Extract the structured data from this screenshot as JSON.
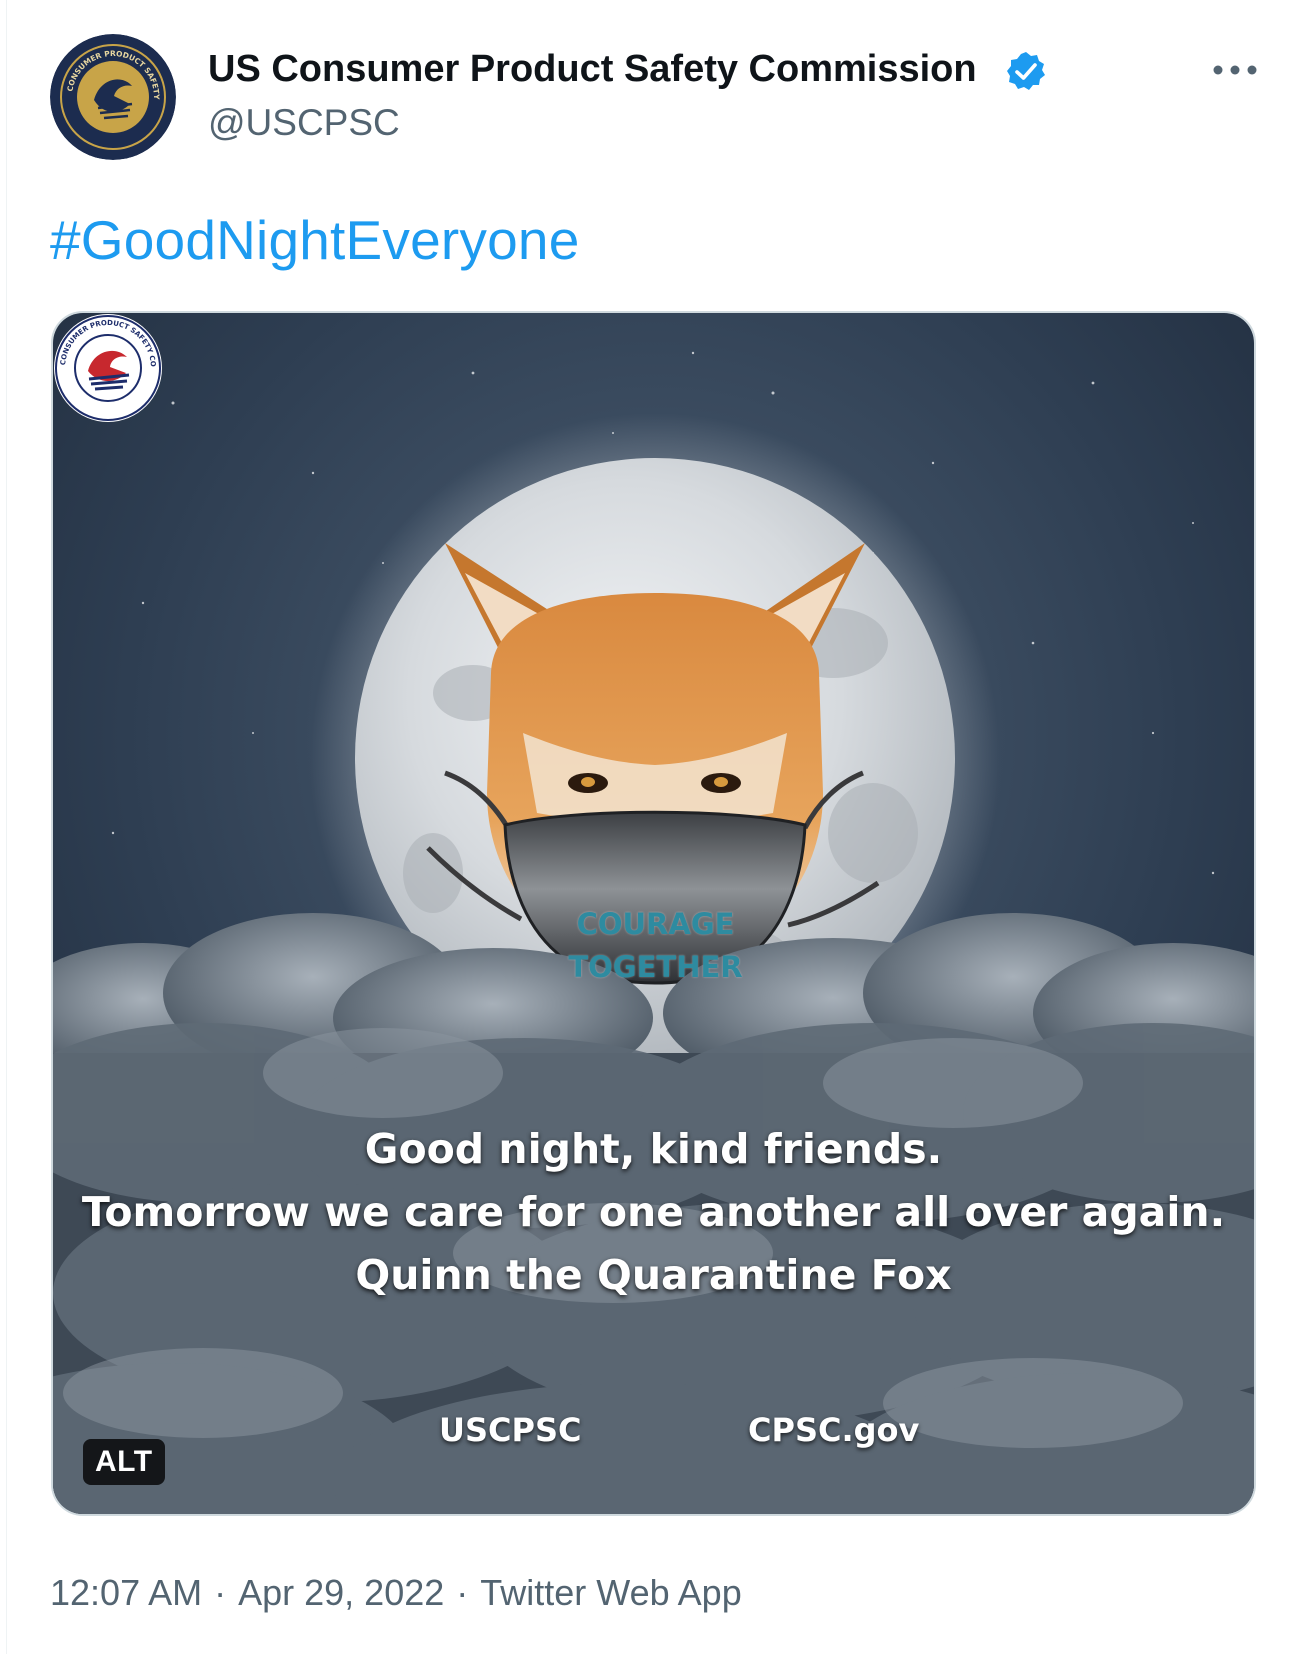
{
  "tweet": {
    "author": {
      "name": "US Consumer Product Safety Commission",
      "handle": "@USCPSC",
      "verified": true,
      "avatar_icon": "cpsc-seal-avatar"
    },
    "more_icon": "more-options-icon",
    "text": "#GoodNightEveryone",
    "media": {
      "mask_text_line1": "COURAGE",
      "mask_text_line2": "TOGETHER",
      "caption_line1": "Good night, kind friends.",
      "caption_line2": "Tomorrow we care for one another all over again.",
      "caption_line3": "Quinn the Quarantine Fox",
      "brand_left": "USCPSC",
      "brand_right": "CPSC.gov",
      "alt_badge": "ALT"
    },
    "time": "12:07 AM",
    "date": "Apr 29, 2022",
    "source": "Twitter Web App",
    "separator": "·"
  },
  "colors": {
    "link": "#1d9bf0",
    "secondary_text": "#536471",
    "verified_badge": "#1d9bf0",
    "mask_text": "#2e8ba0"
  }
}
